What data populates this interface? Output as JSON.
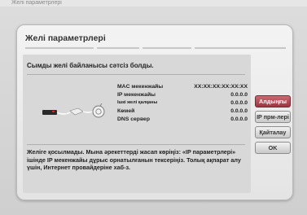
{
  "top_partial_text": "Желі параметрлері",
  "dialog": {
    "title": "Желі параметрлері",
    "message": "Сымды желі байланысы сәтсіз болды.",
    "network_rows": [
      {
        "label": "MAC мекенжайы",
        "value": "XX:XX:XX:XX:XX:XX"
      },
      {
        "label": "IP мекенжайы",
        "value": "0.0.0.0"
      },
      {
        "label": "Ішкі желі қалқаны",
        "value": "0.0.0.0"
      },
      {
        "label": "Көмей",
        "value": "0.0.0.0"
      },
      {
        "label": "DNS сервер",
        "value": "0.0.0.0"
      }
    ],
    "footer_text": "Желіге қосылмады. Мына әрекеттерді жасап көріңіз: «IP параметрлері» ішінде IP мекенжайы дұрыс орнатылғанын тексеріңіз. Толық ақпарат алу үшін, Интернет провайдеріне хаб-з."
  },
  "buttons": {
    "previous": "Алдыңғы",
    "ip_settings": "IP прм-лері",
    "retry": "Қайталау",
    "ok": "OK"
  },
  "selected_button": "previous",
  "colors": {
    "selected": "#b0505a"
  }
}
